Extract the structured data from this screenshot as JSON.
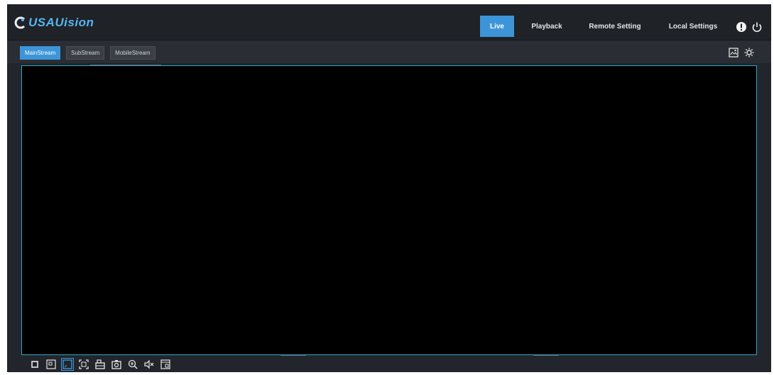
{
  "brand": {
    "name": "USAUision",
    "accent": "#55b7f0"
  },
  "nav": {
    "items": [
      {
        "label": "Live",
        "active": true
      },
      {
        "label": "Playback",
        "active": false
      },
      {
        "label": "Remote Setting",
        "active": false
      },
      {
        "label": "Local Settings",
        "active": false
      }
    ]
  },
  "header_icons": [
    "info-icon",
    "power-icon"
  ],
  "streams": {
    "tabs": [
      {
        "label": "MainStream",
        "active": true
      },
      {
        "label": "SubStream",
        "active": false
      },
      {
        "label": "MobileStream",
        "active": false
      }
    ]
  },
  "sub_icons": [
    "snapshot-gallery-icon",
    "image-settings-icon"
  ],
  "bottom_tools": [
    "single-screen-icon",
    "window-layout-icon",
    "fullscreen-view-icon",
    "stretch-icon",
    "record-icon",
    "capture-icon",
    "zoom-in-icon",
    "mute-icon",
    "extra-window-icon"
  ],
  "colors": {
    "active": "#3d95d8",
    "video_border": "#2fa9c4",
    "background": "#22252b"
  }
}
